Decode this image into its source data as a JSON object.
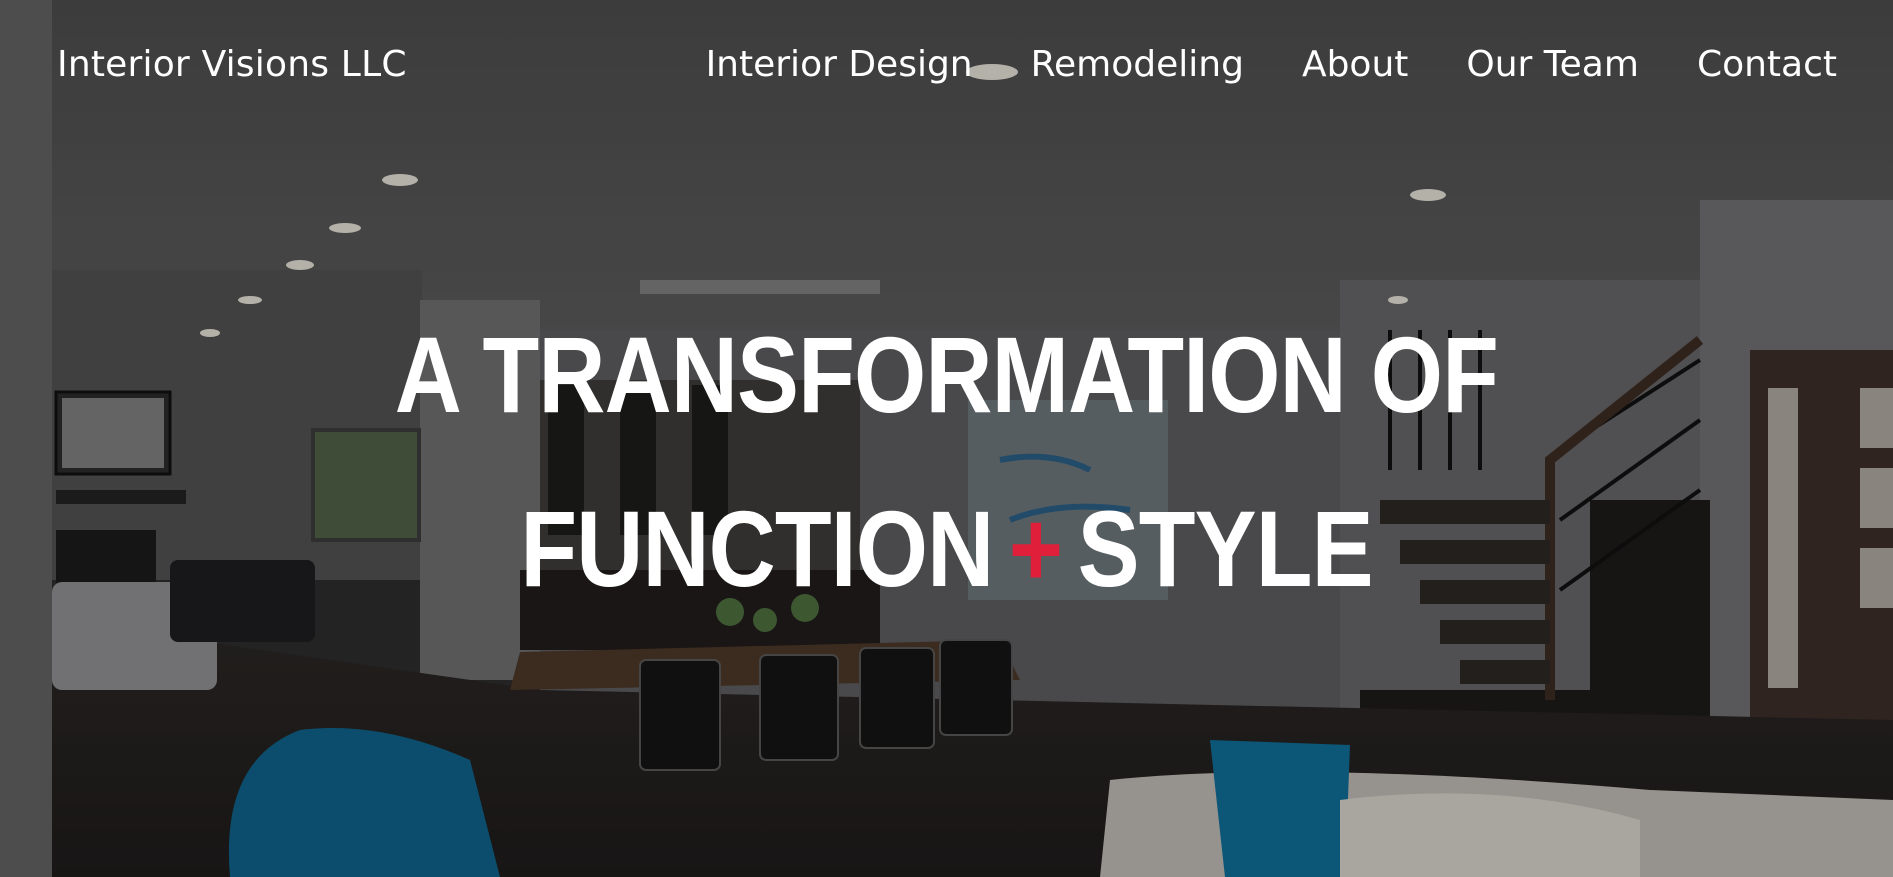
{
  "header": {
    "brand": "Interior Visions LLC",
    "nav": [
      {
        "label": "Interior Design"
      },
      {
        "label": "Remodeling"
      },
      {
        "label": "About"
      },
      {
        "label": "Our Team"
      },
      {
        "label": "Contact"
      }
    ]
  },
  "hero": {
    "headline_line1": "A TRANSFORMATION OF",
    "headline_word_a": "FUNCTION",
    "headline_symbol": "+",
    "headline_word_b": "STYLE"
  },
  "colors": {
    "accent": "#e0203a",
    "text": "#ffffff"
  }
}
